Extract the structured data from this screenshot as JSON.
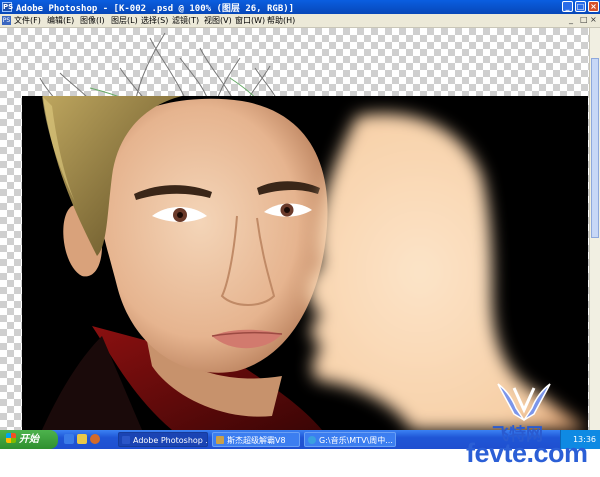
{
  "window": {
    "title": "Adobe Photoshop - [K-002 .psd @ 100% (图层 26, RGB)]",
    "app_icon": "PS",
    "buttons": {
      "minimize": "_",
      "maximize": "□",
      "close": "×"
    }
  },
  "menu": {
    "items": [
      "文件(F)",
      "编辑(E)",
      "图像(I)",
      "图层(L)",
      "选择(S)",
      "滤镜(T)",
      "视图(V)",
      "窗口(W)",
      "帮助(H)"
    ]
  },
  "taskbar": {
    "start_label": "开始",
    "tasks": [
      {
        "label": "Adobe Photoshop ...",
        "active": true,
        "icon_color": "#2b56c8"
      },
      {
        "label": "斯杰超级解霸V8",
        "active": false,
        "icon_color": "#c9a04a"
      },
      {
        "label": "G:\\音乐\\MTV\\周中...",
        "active": false,
        "icon_color": "#3aa0e0"
      }
    ],
    "clock": "13:36"
  },
  "watermark": {
    "cn": "飞特网",
    "en": "fevte.com"
  },
  "colors": {
    "titlebar": "#0a5ee0",
    "taskbar": "#1f56d6",
    "start": "#2f8f2f",
    "watermark": "#2b5fd6"
  }
}
